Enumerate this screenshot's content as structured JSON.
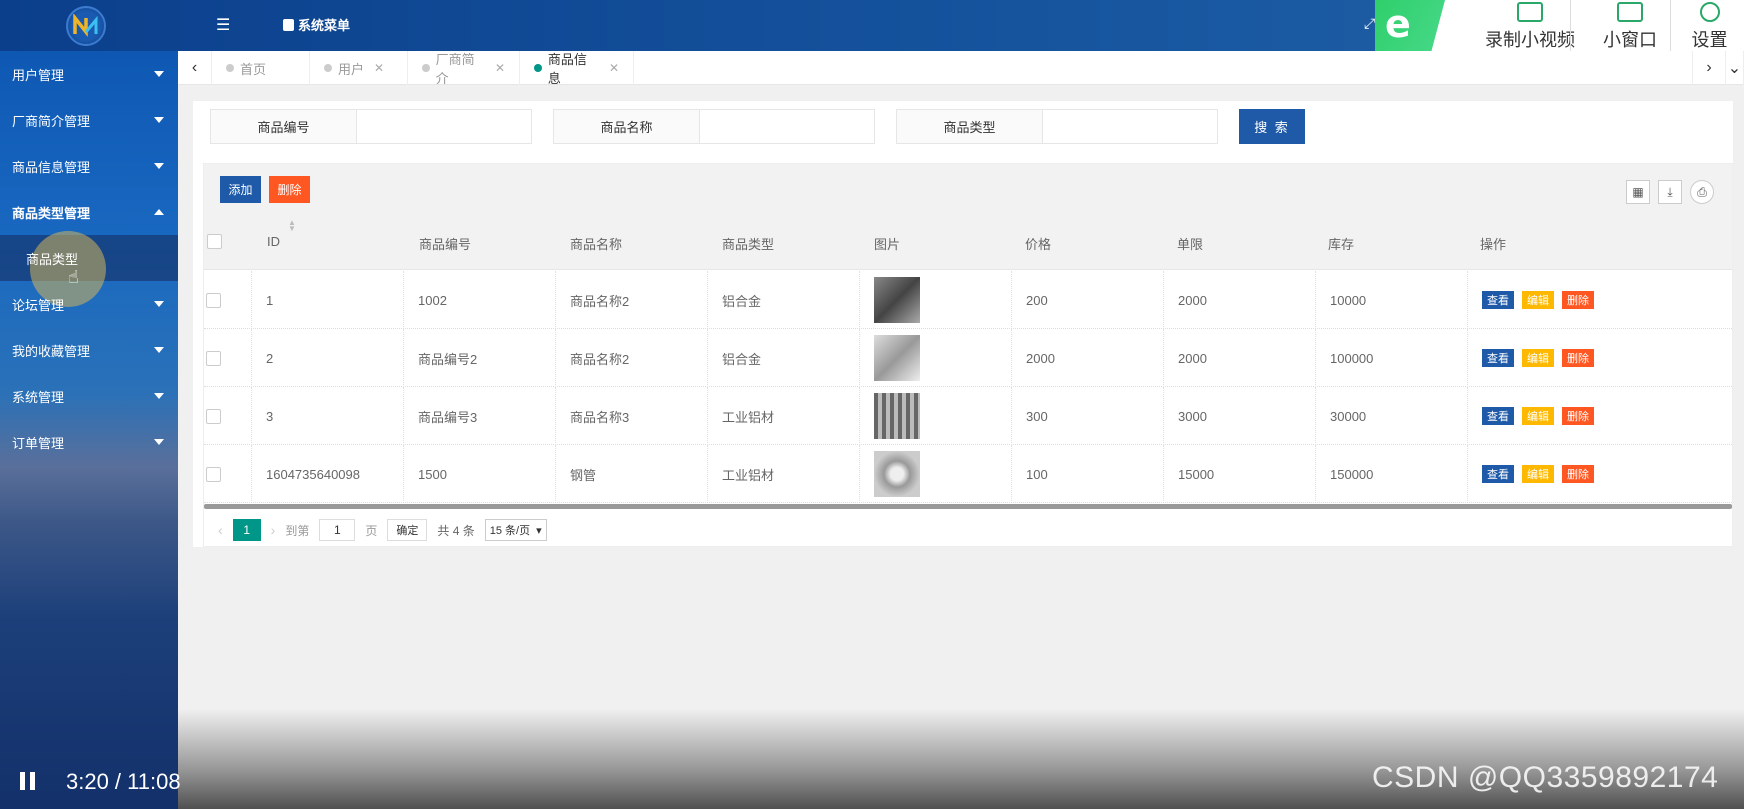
{
  "header": {
    "menu_label": "系统菜单",
    "fullscreen_symbol": "⤢"
  },
  "recorder": {
    "logo_char": "e",
    "items": [
      "录制小视频",
      "小窗口",
      "设置"
    ]
  },
  "sidebar": {
    "items": [
      {
        "label": "用户管理"
      },
      {
        "label": "厂商简介管理"
      },
      {
        "label": "商品信息管理"
      },
      {
        "label": "商品类型管理"
      },
      {
        "label": "论坛管理"
      },
      {
        "label": "我的收藏管理"
      },
      {
        "label": "系统管理"
      },
      {
        "label": "订单管理"
      }
    ],
    "sub_item": "商品类型"
  },
  "tabs": [
    {
      "label": "首页",
      "active": false
    },
    {
      "label": "用户",
      "active": false
    },
    {
      "label": "厂商简介",
      "active": false
    },
    {
      "label": "商品信息",
      "active": true
    }
  ],
  "search": {
    "fields": [
      {
        "label": "商品编号",
        "value": ""
      },
      {
        "label": "商品名称",
        "value": ""
      },
      {
        "label": "商品类型",
        "value": ""
      }
    ],
    "button": "搜 索"
  },
  "toolbar": {
    "add": "添加",
    "delete": "删除",
    "icons": [
      "columns-icon",
      "export-icon",
      "print-icon"
    ]
  },
  "table": {
    "headers": [
      "ID",
      "商品编号",
      "商品名称",
      "商品类型",
      "图片",
      "价格",
      "单限",
      "库存",
      "操作"
    ],
    "rows": [
      {
        "id": "1",
        "code": "1002",
        "name": "商品名称2",
        "type": "铝合金",
        "price": "200",
        "limit": "2000",
        "stock": "10000"
      },
      {
        "id": "2",
        "code": "商品编号2",
        "name": "商品名称2",
        "type": "铝合金",
        "price": "2000",
        "limit": "2000",
        "stock": "100000"
      },
      {
        "id": "3",
        "code": "商品编号3",
        "name": "商品名称3",
        "type": "工业铝材",
        "price": "300",
        "limit": "3000",
        "stock": "30000"
      },
      {
        "id": "1604735640098",
        "code": "1500",
        "name": "钢管",
        "type": "工业铝材",
        "price": "100",
        "limit": "15000",
        "stock": "150000"
      }
    ],
    "ops": {
      "view": "查看",
      "edit": "编辑",
      "delete": "删除"
    }
  },
  "pager": {
    "current": "1",
    "goto_label": "到第",
    "page_input": "1",
    "page_suffix": "页",
    "confirm": "确定",
    "total": "共 4 条",
    "page_size": "15 条/页"
  },
  "video": {
    "time": "3:20 / 11:08",
    "watermark": "CSDN @QQ3359892174"
  },
  "colors": {
    "primary": "#1e5aa8",
    "danger": "#ff5722",
    "warn": "#ffb800",
    "teal": "#009688"
  }
}
